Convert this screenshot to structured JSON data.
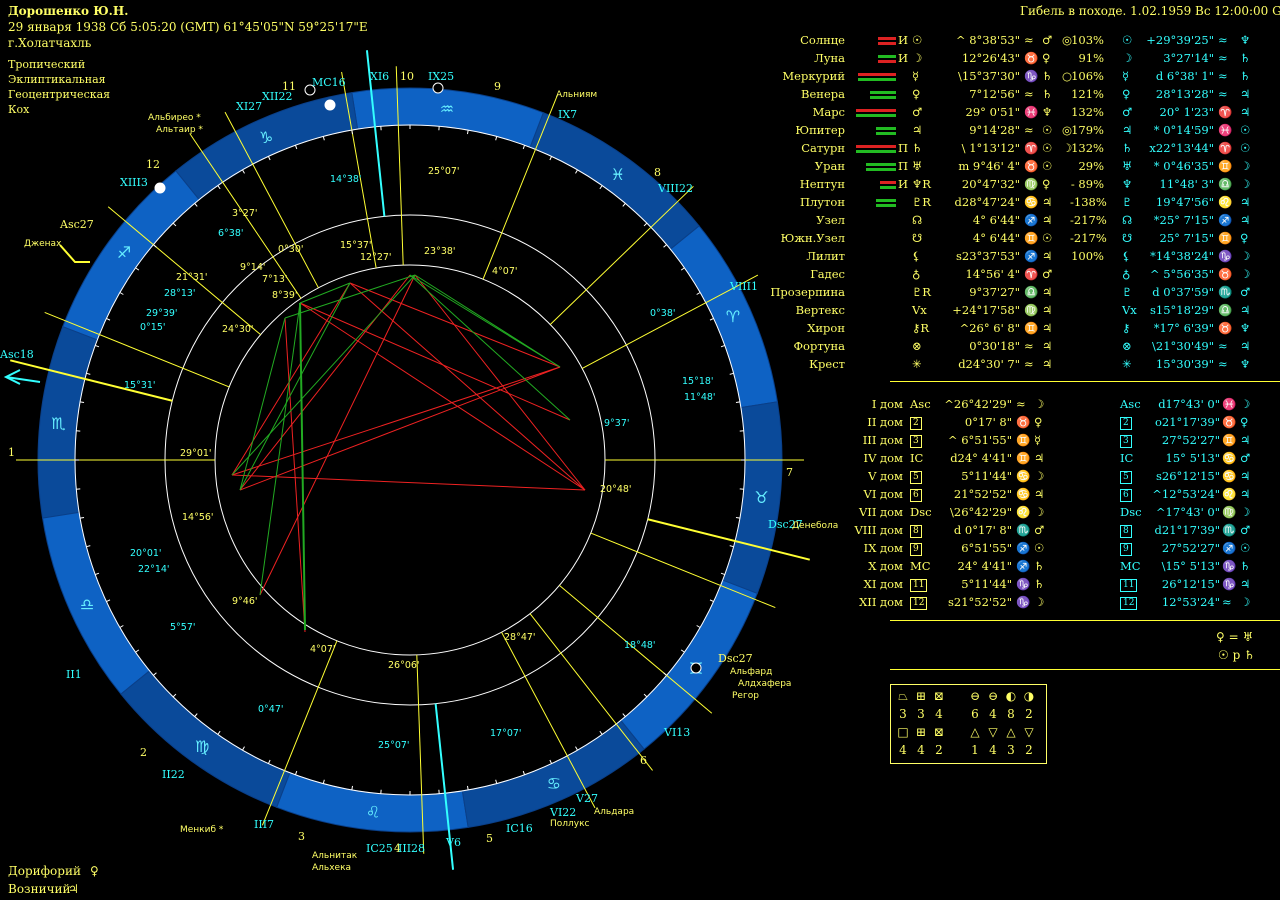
{
  "header": {
    "name": "Дорошенко Ю.Н.",
    "birth": "29 января 1938  Сб   5:05:20 (GMT) 61°45'05\"N  59°25'17\"E",
    "place": "г.Холатчахль",
    "settings": [
      "Тропический",
      "Эклиптикальная",
      "Геоцентрическая",
      "Кох"
    ],
    "event": "Гибель в походе.  1.02.1959  Вс 12:00:00 GMT"
  },
  "stars_bottom": [
    {
      "name": "Дорифорий",
      "glyph": "♀"
    },
    {
      "name": "Возничий",
      "glyph": "♃"
    }
  ],
  "wheel_labels": {
    "stars": [
      "Альдебаран",
      "Альбирео",
      "Альтаир",
      "Альниям",
      "Дженах",
      "Денебола",
      "Альфард",
      "Алдхафера",
      "Регор",
      "Альдара",
      "Поллукс",
      "Менкиб",
      "Альнитак",
      "Альхека"
    ],
    "houses_outer": [
      "MC16",
      "XI6",
      "IX25",
      "IX7",
      "VIII22",
      "VIII1",
      "Dsc27",
      "VI13",
      "VI22",
      "V27",
      "V6",
      "IC25",
      "IC16",
      "IV28",
      "III7",
      "II22",
      "II1",
      "XIII3",
      "Asc27",
      "Asc18",
      "XII22",
      "XI27",
      "MC16"
    ],
    "numbers": [
      "1",
      "2",
      "3",
      "4",
      "5",
      "6",
      "7",
      "8",
      "9",
      "10",
      "11",
      "12"
    ],
    "sign_glyphs": [
      "♑",
      "♐",
      "♏",
      "♎",
      "♍",
      "♌",
      "♋",
      "♊",
      "♉",
      "♈",
      "♓",
      "♒"
    ]
  },
  "planets": [
    {
      "name": "Солнце",
      "g": "И",
      "glyph": "☉",
      "pos": "^ 8°38'53\"",
      "sign": "≈",
      "r1": "♂",
      "r2": "◎",
      "pct": "103%",
      "tglyph": "☉",
      "tpos": "+29°39'25\"",
      "tsign": "≈",
      "truler": "♆"
    },
    {
      "name": "Луна",
      "g": "И",
      "glyph": "☽",
      "pos": "12°26'43\"",
      "sign": "♉",
      "r1": "♀",
      "r2": "",
      "pct": "91%",
      "tglyph": "☽",
      "tpos": "3°27'14\"",
      "tsign": "≈",
      "truler": "♄"
    },
    {
      "name": "Меркурий",
      "g": "",
      "glyph": "☿",
      "pos": "\\15°37'30\"",
      "sign": "♑",
      "r1": "♄",
      "r2": "○",
      "pct": "106%",
      "tglyph": "☿",
      "tpos": "d 6°38' 1\"",
      "tsign": "≈",
      "truler": "♄"
    },
    {
      "name": "Венера",
      "g": "",
      "glyph": "♀",
      "pos": "7°12'56\"",
      "sign": "≈",
      "r1": "♄",
      "r2": "",
      "pct": "121%",
      "tglyph": "♀",
      "tpos": "28°13'28\"",
      "tsign": "≈",
      "truler": "♃"
    },
    {
      "name": "Марс",
      "g": "",
      "glyph": "♂",
      "pos": "29° 0'51\"",
      "sign": "♓",
      "r1": "♆",
      "r2": "",
      "pct": "132%",
      "tglyph": "♂",
      "tpos": "20° 1'23\"",
      "tsign": "♈",
      "truler": "♃"
    },
    {
      "name": "Юпитер",
      "g": "",
      "glyph": "♃",
      "pos": "9°14'28\"",
      "sign": "≈",
      "r1": "☉",
      "r2": "◎",
      "pct": "179%",
      "tglyph": "♃",
      "tpos": "* 0°14'59\"",
      "tsign": "♓",
      "truler": "☉"
    },
    {
      "name": "Сатурн",
      "g": "П",
      "glyph": "♄",
      "pos": "\\ 1°13'12\"",
      "sign": "♈",
      "r1": "☉",
      "r2": "☽",
      "pct": "132%",
      "tglyph": "♄",
      "tpos": "x22°13'44\"",
      "tsign": "♈",
      "truler": "☉"
    },
    {
      "name": "Уран",
      "g": "П",
      "glyph": "♅",
      "pos": "m 9°46' 4\"",
      "sign": "♉",
      "r1": "☉",
      "r2": "",
      "pct": "29%",
      "tglyph": "♅",
      "tpos": "* 0°46'35\"",
      "tsign": "♊",
      "truler": "☽"
    },
    {
      "name": "Нептун",
      "g": "И",
      "glyph": "♆R",
      "pos": "20°47'32\"",
      "sign": "♍",
      "r1": "♀",
      "r2": "",
      "pct": "- 89%",
      "tglyph": "♆",
      "tpos": "11°48' 3\"",
      "tsign": "♎",
      "truler": "☽"
    },
    {
      "name": "Плутон",
      "g": "",
      "glyph": "♇R",
      "pos": "d28°47'24\"",
      "sign": "♋",
      "r1": "♃",
      "r2": "",
      "pct": "-138%",
      "tglyph": "♇",
      "tpos": "19°47'56\"",
      "tsign": "♌",
      "truler": "♃"
    },
    {
      "name": "Узел",
      "g": "",
      "glyph": "☊",
      "pos": "4° 6'44\"",
      "sign": "♐",
      "r1": "♃",
      "r2": "",
      "pct": "-217%",
      "tglyph": "☊",
      "tpos": "*25° 7'15\"",
      "tsign": "♐",
      "truler": "♃"
    },
    {
      "name": "Южн.Узел",
      "g": "",
      "glyph": "☋",
      "pos": "4° 6'44\"",
      "sign": "♊",
      "r1": "☉",
      "r2": "",
      "pct": "-217%",
      "tglyph": "☋",
      "tpos": "25° 7'15\"",
      "tsign": "♊",
      "truler": "♀"
    },
    {
      "name": "Лилит",
      "g": "",
      "glyph": "⚸",
      "pos": "s23°37'53\"",
      "sign": "♐",
      "r1": "♃",
      "r2": "",
      "pct": "100%",
      "tglyph": "⚸",
      "tpos": "*14°38'24\"",
      "tsign": "♑",
      "truler": "☽"
    },
    {
      "name": "Гадес",
      "g": "",
      "glyph": "♁",
      "pos": "14°56' 4\"",
      "sign": "♈",
      "r1": "♂",
      "r2": "",
      "pct": "",
      "tglyph": "♁",
      "tpos": "^ 5°56'35\"",
      "tsign": "♉",
      "truler": "☽"
    },
    {
      "name": "Прозерпина",
      "g": "",
      "glyph": "♇R",
      "pos": "9°37'27\"",
      "sign": "♎",
      "r1": "♃",
      "r2": "",
      "pct": "",
      "tglyph": "♇",
      "tpos": "d 0°37'59\"",
      "tsign": "♏",
      "truler": "♂"
    },
    {
      "name": "Вертекс",
      "g": "",
      "glyph": "Vx",
      "pos": "+24°17'58\"",
      "sign": "♍",
      "r1": "♃",
      "r2": "",
      "pct": "",
      "tglyph": "Vx",
      "tpos": "s15°18'29\"",
      "tsign": "♎",
      "truler": "♃"
    },
    {
      "name": "Хирон",
      "g": "",
      "glyph": "⚷R",
      "pos": "^26° 6' 8\"",
      "sign": "♊",
      "r1": "♃",
      "r2": "",
      "pct": "",
      "tglyph": "⚷",
      "tpos": "*17° 6'39\"",
      "tsign": "♉",
      "truler": "♆"
    },
    {
      "name": "Фортуна",
      "g": "",
      "glyph": "⊗",
      "pos": "0°30'18\"",
      "sign": "≈",
      "r1": "♃",
      "r2": "",
      "pct": "",
      "tglyph": "⊗",
      "tpos": "\\21°30'49\"",
      "tsign": "≈",
      "truler": "♃"
    },
    {
      "name": "Крест",
      "g": "",
      "glyph": "✳",
      "pos": "d24°30' 7\"",
      "sign": "≈",
      "r1": "♃",
      "r2": "",
      "pct": "",
      "tglyph": "✳",
      "tpos": "15°30'39\"",
      "tsign": "≈",
      "truler": "♆"
    }
  ],
  "houses": [
    {
      "name": "I дом",
      "g": "Asc",
      "pos": "^26°42'29\"",
      "sign": "≈",
      "r": "☽",
      "tg": "Asc",
      "tpos": "d17°43' 0\"",
      "tsign": "♓",
      "tr": "☽"
    },
    {
      "name": "II дом",
      "g": "2",
      "pos": "0°17' 8\"",
      "sign": "♉",
      "r": "♀",
      "tg": "2",
      "tpos": "o21°17'39\"",
      "tsign": "♉",
      "tr": "♀"
    },
    {
      "name": "III дом",
      "g": "3",
      "pos": "^ 6°51'55\"",
      "sign": "♊",
      "r": "☿",
      "tg": "3",
      "tpos": "27°52'27\"",
      "tsign": "♊",
      "tr": "♃"
    },
    {
      "name": "IV дом",
      "g": "IC",
      "pos": "d24° 4'41\"",
      "sign": "♊",
      "r": "♃",
      "tg": "IC",
      "tpos": "15° 5'13\"",
      "tsign": "♋",
      "tr": "♂"
    },
    {
      "name": "V дом",
      "g": "5",
      "pos": "5°11'44\"",
      "sign": "♋",
      "r": "☽",
      "tg": "5",
      "tpos": "s26°12'15\"",
      "tsign": "♋",
      "tr": "♃"
    },
    {
      "name": "VI дом",
      "g": "6",
      "pos": "21°52'52\"",
      "sign": "♋",
      "r": "♃",
      "tg": "6",
      "tpos": "^12°53'24\"",
      "tsign": "♌",
      "tr": "♃"
    },
    {
      "name": "VII дом",
      "g": "Dsc",
      "pos": "\\26°42'29\"",
      "sign": "♌",
      "r": "☽",
      "tg": "Dsc",
      "tpos": "^17°43' 0\"",
      "tsign": "♍",
      "tr": "☽"
    },
    {
      "name": "VIII дом",
      "g": "8",
      "pos": "d 0°17' 8\"",
      "sign": "♏",
      "r": "♂",
      "tg": "8",
      "tpos": "d21°17'39\"",
      "tsign": "♏",
      "tr": "♂"
    },
    {
      "name": "IX дом",
      "g": "9",
      "pos": "6°51'55\"",
      "sign": "♐",
      "r": "☉",
      "tg": "9",
      "tpos": "27°52'27\"",
      "tsign": "♐",
      "tr": "☉"
    },
    {
      "name": "X дом",
      "g": "MC",
      "pos": "24° 4'41\"",
      "sign": "♐",
      "r": "♄",
      "tg": "MC",
      "tpos": "\\15° 5'13\"",
      "tsign": "♑",
      "tr": "♄"
    },
    {
      "name": "XI дом",
      "g": "11",
      "pos": "5°11'44\"",
      "sign": "♑",
      "r": "♄",
      "tg": "11",
      "tpos": "26°12'15\"",
      "tsign": "♑",
      "tr": "♃"
    },
    {
      "name": "XII дом",
      "g": "12",
      "pos": "s21°52'52\"",
      "sign": "♑",
      "r": "☽",
      "tg": "12",
      "tpos": "12°53'24\"",
      "tsign": "≈",
      "tr": "☽"
    }
  ],
  "aspects_extra": [
    "♀ = ♅",
    "☉ p ♄"
  ],
  "stats": {
    "row1_glyphs": [
      "⏢",
      "⊞",
      "⊠",
      "⊖",
      "⊖",
      "◐",
      "◑"
    ],
    "row1_values": [
      "3",
      "3",
      "4",
      "6",
      "4",
      "8",
      "2"
    ],
    "row2_glyphs": [
      "□",
      "⊞",
      "⊠",
      "△",
      "▽",
      "△",
      "▽"
    ],
    "row2_values": [
      "4",
      "4",
      "2",
      "1",
      "4",
      "3",
      "2"
    ]
  }
}
